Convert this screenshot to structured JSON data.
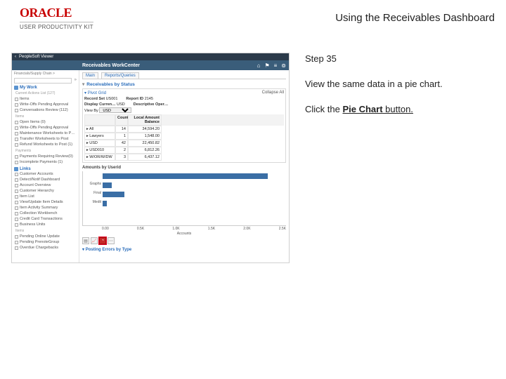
{
  "header": {
    "logo_text": "ORACLE",
    "upk_text": "USER PRODUCTIVITY KIT",
    "title": "Using the Receivables Dashboard"
  },
  "steps": {
    "step_label": "Step 35",
    "instruction1": "View the same data in a pie chart.",
    "instruction2_pre": "Click the ",
    "instruction2_btn": "Pie Chart",
    "instruction2_post": " button."
  },
  "app": {
    "viewer_title": "PeopleSoft Viewer",
    "workcenter_title": "Receivables WorkCenter",
    "icons": {
      "home": "⌂",
      "flag": "⚑",
      "menu": "≡",
      "gear": "⊚"
    },
    "breadcrumb_prefix": "Financials/Supply Chain >",
    "search_placeholder": "",
    "my_work_label": "My Work",
    "links_label": "Links",
    "sidebar_groups": [
      {
        "label": "Current Actions List (127)",
        "items": [
          {
            "label": "Items"
          },
          {
            "label": "Write-Offs Pending Approval"
          },
          {
            "label": "Conversations Review (112)"
          }
        ]
      },
      {
        "label": "Items",
        "items": [
          {
            "label": "Open Items (0)"
          },
          {
            "label": "Write-Offs Pending Approval"
          },
          {
            "label": "Maintenance Worksheets to Po…"
          },
          {
            "label": "Transfer Worksheets to Post"
          },
          {
            "label": "Refund Worksheets to Post (1)"
          }
        ]
      },
      {
        "label": "Payments",
        "items": [
          {
            "label": "Payments Requiring Review(0)"
          },
          {
            "label": "Incomplete Payments (1)"
          }
        ]
      }
    ],
    "links_items": [
      "Customer Accounts",
      "Detect/Notif Dashboard",
      "Account Overview",
      "Customer Hierarchy",
      "Item List",
      "View/Update Item Details",
      "Item Activity Summary",
      "Collection Workbench",
      "Credit Card Transactions",
      "Business Units"
    ],
    "links_items2": [
      "Pending Online Update",
      "Pending PrenoteGroup",
      "Overdue Chargebacks"
    ],
    "tabs": [
      "Main",
      "Reports/Queries"
    ],
    "pivot": {
      "panel_label": "Receivables by Status",
      "grid_label": "Pivot Grid",
      "collapse_label": "Collapse All",
      "row1": [
        {
          "k": "Record Set",
          "v": "US001"
        },
        {
          "k": "Report ID",
          "v": "2145"
        }
      ],
      "row2": [
        {
          "k": "Display Curren…",
          "v": "USD"
        },
        {
          "k": "Descriptive Oper…",
          "v": ""
        }
      ],
      "filter_label": "View By",
      "filter_value": "USD",
      "grid_header": [
        "",
        "Count",
        "Local Amount Balance"
      ],
      "grid_rows": [
        [
          "All",
          "14",
          "34,594.20"
        ],
        [
          "Lawyers",
          "1",
          "1,548.00"
        ],
        [
          "USD",
          "42",
          "22,450.82"
        ],
        [
          "USD010",
          "2",
          "6,812.26"
        ],
        [
          "W/OR/W/DW",
          "3",
          "6,437.12"
        ]
      ]
    },
    "chart": {
      "title": "Amounts by Userid",
      "xaxis_title": "Accounts",
      "footer": "Posting Errors by Type"
    }
  },
  "chart_data": {
    "type": "bar",
    "orientation": "horizontal",
    "title": "Amounts by Userid",
    "categories": [
      "",
      "Graphs",
      "Final",
      "Medit"
    ],
    "values": [
      2250,
      120,
      300,
      60
    ],
    "xlabel": "Accounts",
    "xlim": [
      0,
      2500
    ],
    "xticks": [
      "0.00",
      "0.5K",
      "1.0K",
      "1.5K",
      "2.0K",
      "2.5K"
    ]
  }
}
